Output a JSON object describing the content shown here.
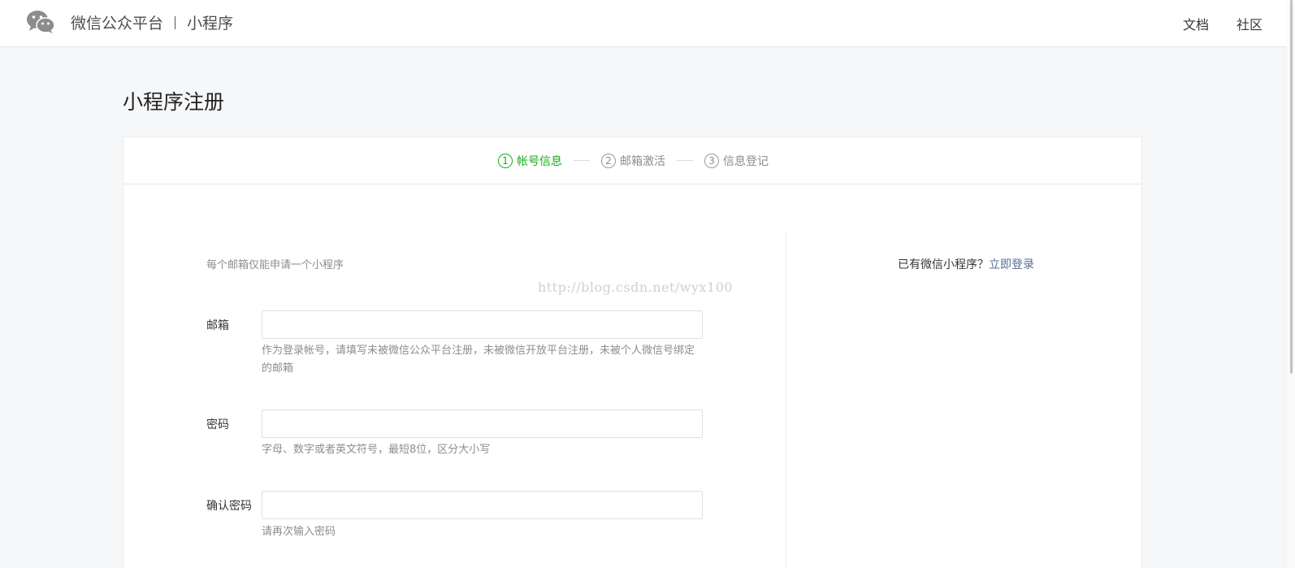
{
  "header": {
    "brand_name": "微信公众平台",
    "product": "小程序",
    "nav": [
      "文档",
      "社区"
    ]
  },
  "page_title": "小程序注册",
  "steps": [
    {
      "num": "1",
      "label": "帐号信息",
      "active": true
    },
    {
      "num": "2",
      "label": "邮箱激活",
      "active": false
    },
    {
      "num": "3",
      "label": "信息登记",
      "active": false
    }
  ],
  "form": {
    "note": "每个邮箱仅能申请一个小程序",
    "watermark": "http://blog.csdn.net/wyx100",
    "email": {
      "label": "邮箱",
      "value": "",
      "tip": "作为登录帐号，请填写未被微信公众平台注册，未被微信开放平台注册，未被个人微信号绑定的邮箱"
    },
    "password": {
      "label": "密码",
      "value": "",
      "tip": "字母、数字或者英文符号，最短8位，区分大小写"
    },
    "confirm_password": {
      "label": "确认密码",
      "value": "",
      "tip": "请再次输入密码"
    }
  },
  "sidebar": {
    "login_prompt": "已有微信小程序？",
    "login_link": "立即登录"
  },
  "colors": {
    "accent_green": "#1aad19",
    "link_blue": "#576b95"
  },
  "icons": {
    "logo": "wechat-logo-icon"
  }
}
